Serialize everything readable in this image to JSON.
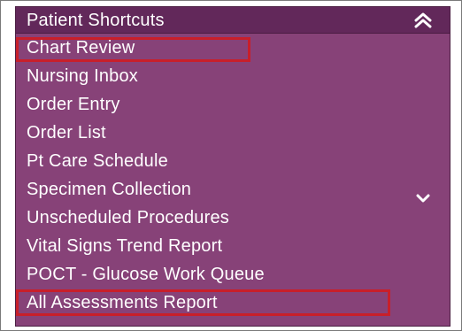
{
  "header": {
    "title": "Patient Shortcuts",
    "collapse_icon": "double-chevron-up-icon"
  },
  "shortcuts": {
    "items": [
      {
        "label": "Chart Review",
        "highlighted": true
      },
      {
        "label": "Nursing Inbox"
      },
      {
        "label": "Order Entry"
      },
      {
        "label": "Order List"
      },
      {
        "label": "Pt Care Schedule"
      },
      {
        "label": "Specimen Collection"
      },
      {
        "label": "Unscheduled Procedures"
      },
      {
        "label": "Vital Signs Trend Report"
      },
      {
        "label": "POCT - Glucose Work Queue"
      },
      {
        "label": "All Assessments Report",
        "highlighted": true
      }
    ],
    "scroll_icon": "chevron-down-icon"
  },
  "colors": {
    "panel_background": "#874278",
    "header_background": "#62285a",
    "highlight_border": "#c81f2a",
    "text": "#ffffff"
  }
}
